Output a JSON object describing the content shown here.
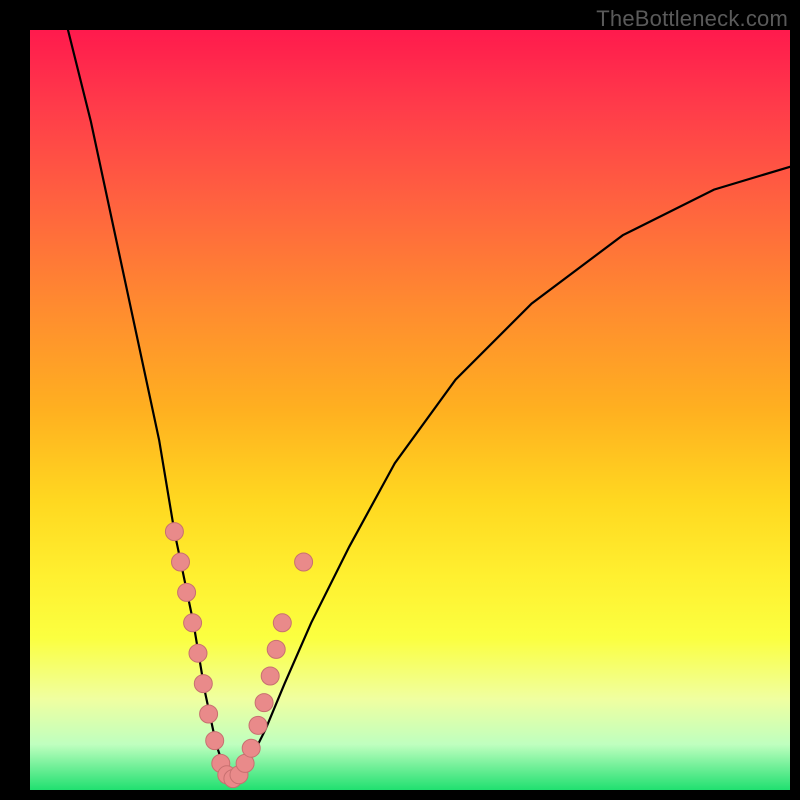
{
  "watermark": "TheBottleneck.com",
  "colors": {
    "curve_stroke": "#000000",
    "marker_fill": "#e98a8a",
    "marker_stroke": "#c77070"
  },
  "chart_data": {
    "type": "line",
    "title": "",
    "xlabel": "",
    "ylabel": "",
    "xlim": [
      0,
      100
    ],
    "ylim": [
      0,
      100
    ],
    "note": "Values are percentage positions within the plot area (0–100). y is plotted from bottom (0) to top (100). The curve descends from top-left to a minimum near x≈25 then rises toward the right.",
    "series": [
      {
        "name": "curve",
        "x": [
          5,
          8,
          11,
          14,
          17,
          19,
          21.5,
          23,
          24.5,
          26,
          27.5,
          29,
          31,
          33.5,
          37,
          42,
          48,
          56,
          66,
          78,
          90,
          100
        ],
        "y": [
          100,
          88,
          74,
          60,
          46,
          34,
          22,
          13,
          6,
          1.5,
          2,
          4,
          8,
          14,
          22,
          32,
          43,
          54,
          64,
          73,
          79,
          82
        ]
      }
    ],
    "markers": [
      {
        "x": 19.0,
        "y": 34
      },
      {
        "x": 19.8,
        "y": 30
      },
      {
        "x": 20.6,
        "y": 26
      },
      {
        "x": 21.4,
        "y": 22
      },
      {
        "x": 22.1,
        "y": 18
      },
      {
        "x": 22.8,
        "y": 14
      },
      {
        "x": 23.5,
        "y": 10
      },
      {
        "x": 24.3,
        "y": 6.5
      },
      {
        "x": 25.1,
        "y": 3.5
      },
      {
        "x": 25.9,
        "y": 2.0
      },
      {
        "x": 26.7,
        "y": 1.5
      },
      {
        "x": 27.5,
        "y": 2.0
      },
      {
        "x": 28.3,
        "y": 3.5
      },
      {
        "x": 29.1,
        "y": 5.5
      },
      {
        "x": 30.0,
        "y": 8.5
      },
      {
        "x": 30.8,
        "y": 11.5
      },
      {
        "x": 31.6,
        "y": 15.0
      },
      {
        "x": 32.4,
        "y": 18.5
      },
      {
        "x": 33.2,
        "y": 22.0
      },
      {
        "x": 36.0,
        "y": 30.0
      }
    ]
  }
}
